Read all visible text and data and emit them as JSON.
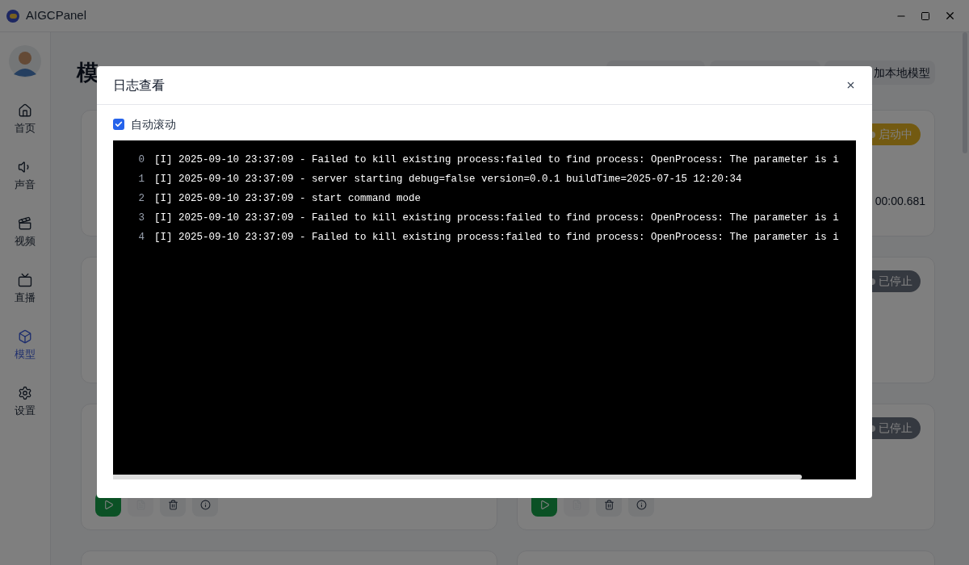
{
  "window": {
    "title": "AIGCPanel"
  },
  "sidebar": {
    "items": [
      {
        "label": "首页",
        "selected": false
      },
      {
        "label": "声音",
        "selected": false
      },
      {
        "label": "视频",
        "selected": false
      },
      {
        "label": "直播",
        "selected": false
      },
      {
        "label": "模型",
        "selected": true
      },
      {
        "label": "设置",
        "selected": false
      }
    ]
  },
  "page": {
    "heading": "模",
    "add_button": "加本地模型"
  },
  "cards": [
    {
      "kind": "model"
    },
    {
      "kind": "model",
      "status": {
        "label": "启动中",
        "kind": "starting"
      },
      "time": "00:00.681"
    },
    {
      "kind": "model"
    },
    {
      "kind": "model",
      "status": {
        "label": "已停止",
        "kind": "stopped"
      }
    },
    {
      "kind": "model",
      "actions": [
        {
          "kind": "play",
          "disabled": false
        },
        {
          "kind": "log",
          "disabled": true
        },
        {
          "kind": "delete",
          "disabled": false
        },
        {
          "kind": "info",
          "disabled": false
        }
      ]
    },
    {
      "kind": "model",
      "status": {
        "label": "已停止",
        "kind": "stopped"
      },
      "actions": [
        {
          "kind": "play",
          "disabled": false
        },
        {
          "kind": "log",
          "disabled": true
        },
        {
          "kind": "delete",
          "disabled": false
        },
        {
          "kind": "info",
          "disabled": false
        }
      ]
    },
    {
      "kind": "model"
    },
    {
      "kind": "model"
    }
  ],
  "dialog": {
    "title": "日志查看",
    "auto_scroll": {
      "label": "自动滚动",
      "checked": true
    },
    "log_lines": [
      {
        "number": "0",
        "text": "[I] 2025-09-10 23:37:09 - Failed to kill existing process:failed to find process: OpenProcess: The parameter is i"
      },
      {
        "number": "1",
        "text": "[I] 2025-09-10 23:37:09 - server starting debug=false version=0.0.1 buildTime=2025-07-15 12:20:34"
      },
      {
        "number": "2",
        "text": "[I] 2025-09-10 23:37:09 - start command mode"
      },
      {
        "number": "3",
        "text": "[I] 2025-09-10 23:37:09 - Failed to kill existing process:failed to find process: OpenProcess: The parameter is i"
      },
      {
        "number": "4",
        "text": "[I] 2025-09-10 23:37:09 - Failed to kill existing process:failed to find process: OpenProcess: The parameter is i"
      }
    ]
  }
}
